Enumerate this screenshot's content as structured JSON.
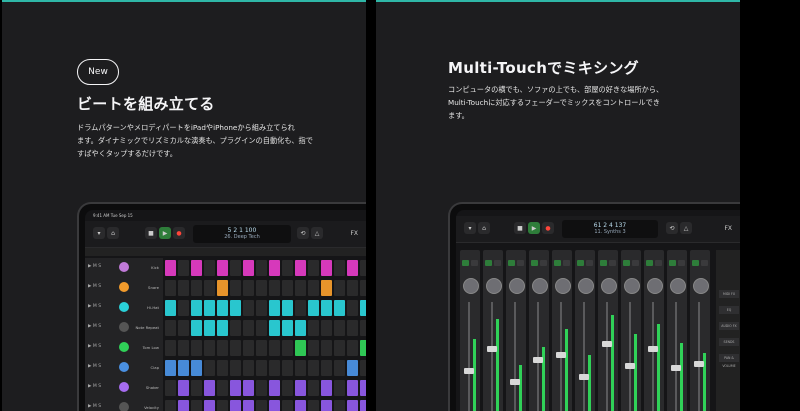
{
  "left": {
    "badge": "New",
    "title": "ビートを組み立てる",
    "description": "ドラムパターンやメロディパートをiPadやiPhoneから組み立てられ\nます。ダイナミックでリズミカルな演奏も、プラグインの自動化も、指で\nすばやくタップするだけです。",
    "ipad": {
      "status_time": "9:41 AM   Tue Sep 15",
      "lcd_line1": "5  2  1  100",
      "lcd_line2": "26. Deep Tech",
      "fx_label": "FX",
      "tracks": [
        {
          "name": "Kick",
          "icon_color": "#c07ad8",
          "cell_color": "#e03bc4",
          "pattern": [
            1,
            0,
            1,
            0,
            1,
            0,
            1,
            0,
            1,
            0,
            1,
            0,
            1,
            0,
            1,
            0
          ]
        },
        {
          "name": "Snare",
          "icon_color": "#f29b2c",
          "cell_color": "#f29b2c",
          "pattern": [
            0,
            0,
            0,
            0,
            1,
            0,
            0,
            0,
            0,
            0,
            0,
            0,
            1,
            0,
            0,
            0
          ]
        },
        {
          "name": "Hi-Hat",
          "icon_color": "#2ad0d8",
          "cell_color": "#2ad0d8",
          "pattern": [
            1,
            0,
            1,
            1,
            1,
            1,
            0,
            0,
            1,
            1,
            0,
            1,
            1,
            1,
            0,
            1
          ]
        },
        {
          "name": "Note Repeat",
          "icon_color": "#555",
          "cell_color": "#2ad0d8",
          "pattern": [
            0,
            0,
            1,
            1,
            1,
            0,
            0,
            0,
            1,
            1,
            1,
            0,
            0,
            0,
            0,
            0
          ]
        },
        {
          "name": "Tom Low",
          "icon_color": "#30d158",
          "cell_color": "#30d158",
          "pattern": [
            0,
            0,
            0,
            0,
            0,
            0,
            0,
            0,
            0,
            0,
            1,
            0,
            0,
            0,
            0,
            1
          ]
        },
        {
          "name": "Clap",
          "icon_color": "#4a90e2",
          "cell_color": "#4a90e2",
          "pattern": [
            1,
            1,
            1,
            0,
            0,
            0,
            0,
            0,
            0,
            0,
            0,
            0,
            0,
            0,
            1,
            0
          ]
        },
        {
          "name": "Shaker",
          "icon_color": "#a66cf0",
          "cell_color": "#8e5ae8",
          "pattern": [
            0,
            1,
            0,
            1,
            0,
            1,
            1,
            0,
            1,
            0,
            1,
            0,
            1,
            0,
            1,
            1
          ]
        },
        {
          "name": "Velocity",
          "icon_color": "#555",
          "cell_color": "#8e5ae8",
          "pattern": [
            0,
            1,
            0,
            1,
            0,
            1,
            1,
            0,
            1,
            0,
            1,
            0,
            1,
            0,
            1,
            1
          ]
        }
      ]
    }
  },
  "right": {
    "title": "Multi-Touchでミキシング",
    "description": "コンピュータの横でも、ソファの上でも、部屋の好きな場所から、\nMulti-Touchに対応するフェーダーでミックスをコントロールでき\nます。",
    "ipad": {
      "lcd_line1": "61  2  4  137",
      "lcd_line2": "11. Synths 3",
      "fx_label": "FX",
      "channels": [
        {
          "level": 0.62,
          "fader": 0.35
        },
        {
          "level": 0.78,
          "fader": 0.55
        },
        {
          "level": 0.4,
          "fader": 0.25
        },
        {
          "level": 0.55,
          "fader": 0.45
        },
        {
          "level": 0.7,
          "fader": 0.5
        },
        {
          "level": 0.48,
          "fader": 0.3
        },
        {
          "level": 0.82,
          "fader": 0.6
        },
        {
          "level": 0.66,
          "fader": 0.4
        },
        {
          "level": 0.74,
          "fader": 0.55
        },
        {
          "level": 0.58,
          "fader": 0.38
        },
        {
          "level": 0.5,
          "fader": 0.42
        }
      ],
      "master_labels": [
        "MIDI FX",
        "EQ",
        "AUDIO FX",
        "SENDS",
        "PAN & VOLUME"
      ]
    }
  }
}
